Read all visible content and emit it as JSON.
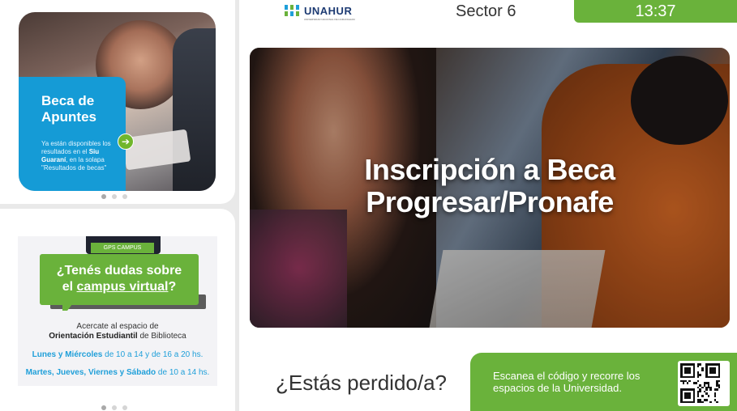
{
  "header": {
    "logo_text": "UNAHUR",
    "logo_subtext": "UNIVERSIDAD NACIONAL DE HURLINGHAM",
    "sector": "Sector 6",
    "clock": "13:37"
  },
  "sidebar": {
    "promo_top": {
      "title_line1": "Beca de",
      "title_line2": "Apuntes",
      "text_part1": "Ya están disponibles los resultados en el",
      "text_bold": "Siu Guaraní",
      "text_part2": ", en la solapa \"Resultados de becas\"",
      "arrow_icon": "arrow-right-icon"
    },
    "promo_bottom": {
      "tag": "GPS CAMPUS",
      "bubble_line1": "¿Tenés dudas sobre",
      "bubble_line2_prefix": "el ",
      "bubble_line2_link": "campus virtual",
      "bubble_line2_suffix": "?",
      "info_line1": "Acercate al espacio de",
      "info_line2_bold": "Orientación Estudiantil",
      "info_line2_rest": " de Biblioteca",
      "schedule1_days": "Lunes y Miércoles",
      "schedule1_hours": " de 10 a 14 y de 16 a 20 hs.",
      "schedule2_days": "Martes, Jueves, Viernes y Sábado",
      "schedule2_hours": " de 10 a 14 hs."
    }
  },
  "main": {
    "hero_title_line1": "Inscripción a Beca",
    "hero_title_line2": "Progresar/Pronafe",
    "lost_text": "¿Estás perdido/a?",
    "qr_text": "Escanea el código y recorre los espacios de la Universidad.",
    "qr_icon": "qr-code-icon"
  },
  "colors": {
    "brand_green": "#6ab23b",
    "brand_blue": "#159bd6",
    "logo_navy": "#1d3b73"
  }
}
